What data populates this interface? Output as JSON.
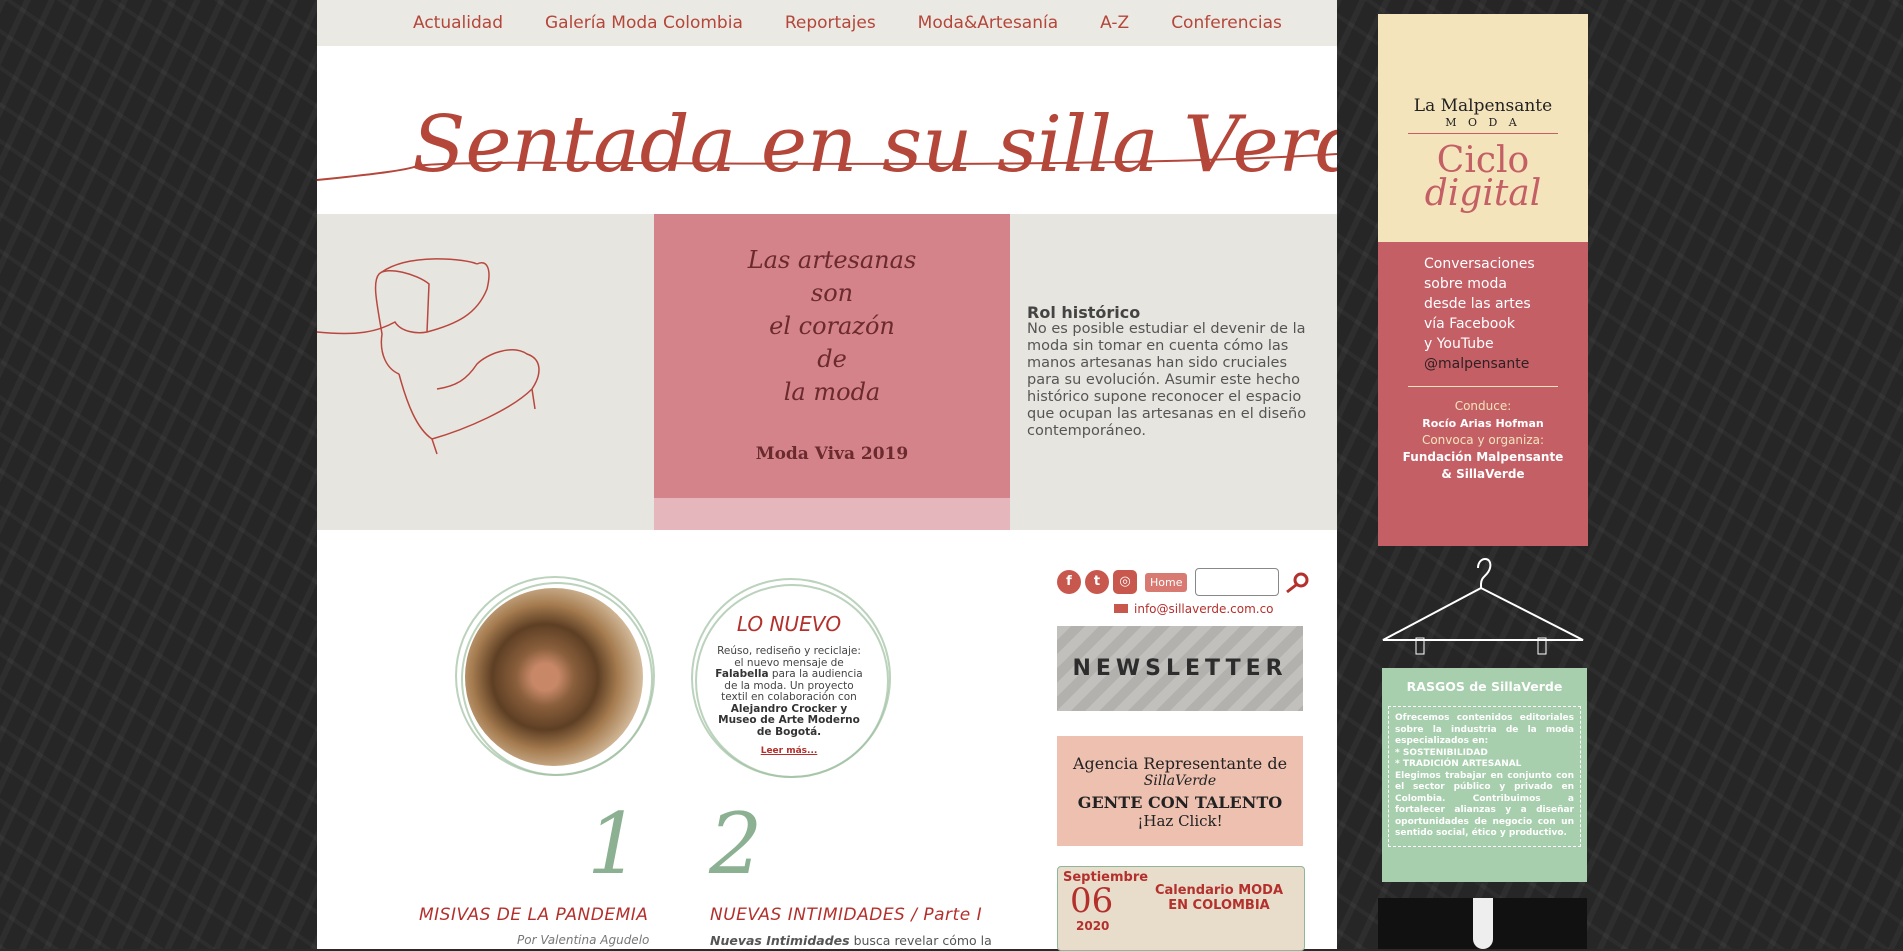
{
  "nav": {
    "items": [
      "Actualidad",
      "Galería Moda Colombia",
      "Reportajes",
      "Moda&Artesanía",
      "A-Z",
      "Conferencias"
    ]
  },
  "masthead": {
    "logo_text": "Sentada en su silla Verde"
  },
  "hero": {
    "quote_lines": [
      "Las artesanas",
      "son",
      "el corazón",
      "de",
      "la moda"
    ],
    "event": "Moda Viva 2019",
    "title": "Rol histórico",
    "body": "No es posible estudiar el devenir de la moda sin tomar en cuenta cómo las manos artesanas han sido cruciales para su evolución. Asumir este hecho histórico supone reconocer el espacio que ocupan las artesanas en el diseño contemporáneo."
  },
  "lo_nuevo": {
    "heading": "LO NUEVO",
    "body_pre": "Reúso, rediseño y reciclaje: el nuevo mensaje de ",
    "body_brand": "Falabella",
    "body_mid": " para la audiencia de la moda. Un proyecto textil en colaboración con ",
    "body_collab": "Alejandro Crocker y Museo de Arte Moderno de Bogotá.",
    "more": "Leer más..."
  },
  "articles": [
    {
      "num": "1",
      "title": "MISIVAS DE LA PANDEMIA",
      "byline": "Por Valentina Agudelo"
    },
    {
      "num": "2",
      "title": "NUEVAS INTIMIDADES / Parte I",
      "snippet_bold": "Nuevas Intimidades",
      "snippet": " busca revelar cómo la"
    }
  ],
  "sidebar": {
    "home_label": "Home",
    "email": "info@sillaverde.com.co",
    "newsletter": "NEWSLETTER",
    "agency_line1": "Agencia Representante de",
    "agency_line2": "SillaVerde",
    "agency_line3": "GENTE CON TALENTO",
    "agency_line4": "¡Haz Click!",
    "cal_month": "Septiembre",
    "cal_day": "06",
    "cal_year": "2020",
    "cal_title": "Calendario MODA EN COLOMBIA"
  },
  "ad": {
    "brand": "La Malpensante",
    "brand_sub": "M O D A",
    "title1": "Ciclo",
    "title2": "digital",
    "lines": [
      "Conversaciones",
      "sobre moda",
      "desde las artes",
      "vía Facebook",
      "y YouTube"
    ],
    "handle": "@malpensante",
    "conduce": "Conduce:",
    "host": "Rocío Arias Hofman",
    "convoca": "Convoca y organiza:",
    "org1": "Fundación Malpensante",
    "org2": "& SillaVerde"
  },
  "rasgos": {
    "heading": "RASGOS de SillaVerde",
    "text": "Ofrecemos contenidos editoriales sobre la industria de la moda especializados en:",
    "item1": "* SOSTENIBILIDAD",
    "item2": "* TRADICIÓN ARTESANAL",
    "text2": "Elegimos trabajar en conjunto con el sector público y privado en Colombia. Contribuimos a fortalecer alianzas y a diseñar oportunidades de negocio con un sentido social, ético y productivo."
  },
  "colors": {
    "brand_red": "#b4463a",
    "accent_green": "#8bb092",
    "hero_pink": "#d4838a"
  }
}
